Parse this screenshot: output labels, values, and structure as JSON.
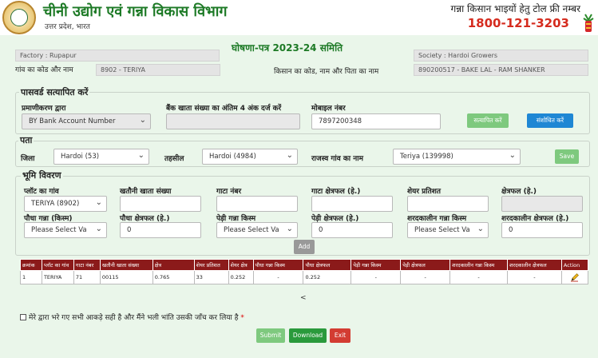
{
  "header": {
    "dept_title": "चीनी उद्योग एवं गन्ना विकास विभाग",
    "dept_sub": "उत्तर प्रदेश, भारत",
    "helpline_title": "गन्ना किसान भाइयों हेतु टोल फ्री नम्बर",
    "helpline_number": "1800-121-3203"
  },
  "form_title": "घोषणा-पत्र 2023-24 समिति",
  "info": {
    "factory": "Factory : Rupapur",
    "society": "Society : Hardoi Growers",
    "village_code_label": "गांव का कोड और नाम",
    "village_code_value": "8902 - TERIYA",
    "farmer_label": "किसान का कोड, नाम और पिता का नाम",
    "farmer_value": "890200517 - BAKE LAL - RAM SHANKER"
  },
  "password_section": {
    "legend": "पासवर्ड सत्यापित करें",
    "auth_label": "प्रमाणीकरण द्वारा",
    "auth_value": "BY Bank Account Number",
    "bank_label": "बैंक खाता संख्या का अंतिम 4 अंक दर्ज करें",
    "bank_value": "",
    "mobile_label": "मोबाइल नंबर",
    "mobile_value": "7897200348",
    "verify_button": "सत्यापित करें",
    "edit_button": "संशोधित करें"
  },
  "address_section": {
    "legend": "पता",
    "district_label": "जिला",
    "district_value": "Hardoi (53)",
    "tehsil_label": "तहसील",
    "tehsil_value": "Hardoi (4984)",
    "revenue_village_label": "राजस्व गांव का नाम",
    "revenue_village_value": "Teriya (139998)",
    "save_button": "Save"
  },
  "land_section": {
    "legend": "भूमि विवरण",
    "plot_village_label": "प्लॉट का गांव",
    "plot_village_value": "TERIYA (8902)",
    "khatauni_label": "खतौनी खाता संख्या",
    "khatauni_value": "",
    "gata_label": "गाटा नंबर",
    "gata_value": "",
    "gata_area_label": "गाटा क्षेत्रफल (हे.)",
    "gata_area_value": "",
    "share_label": "शेयर प्रतिशत",
    "share_value": "",
    "area_label": "क्षेत्रफल (हे.)",
    "area_value": "",
    "plant_variety_label": "पौधा गन्ना (किस्म)",
    "plant_variety_value": "Please Select Va",
    "plant_area_label": "पौधा क्षेत्रफल (हे.)",
    "plant_area_value": "0",
    "ratoon_variety_label": "पेड़ी गन्ना किस्म",
    "ratoon_variety_value": "Please Select Va",
    "ratoon_area_label": "पेड़ी क्षेत्रफल (हे.)",
    "ratoon_area_value": "0",
    "autumn_variety_label": "शरदकालीन गन्ना किस्म",
    "autumn_variety_value": "Please Select Va",
    "autumn_area_label": "शरदकालीन क्षेत्रफल (हे.)",
    "autumn_area_value": "0",
    "add_button": "Add"
  },
  "table": {
    "headers": [
      "क्रमांक",
      "प्लॉट का गांव",
      "गाटा नंबर",
      "खतौनी खाता संख्या",
      "क्षेत्र",
      "शेयर प्रतिशत",
      "शेयर क्षेत्र",
      "पौधा गन्ना किस्म",
      "पौधा क्षेत्रफल",
      "पेड़ी गन्ना किस्म",
      "पेड़ी क्षेत्रफल",
      "शरदकालीन गन्ना किस्म",
      "शरदकालीन क्षेत्रफल",
      "Action"
    ],
    "rows": [
      [
        "1",
        "TERIYA",
        "71",
        "00115",
        "0.765",
        "33",
        "0.252",
        "-",
        "0.252",
        "-",
        "-",
        "-",
        "-"
      ]
    ],
    "pager": "<"
  },
  "declaration": "मेरे द्वारा भरे गए सभी आकड़े सही है और मैंने भली भांति उसकी जाँच कर लिया है",
  "footer_buttons": {
    "submit": "Submit",
    "download": "Download",
    "exit": "Exit"
  }
}
